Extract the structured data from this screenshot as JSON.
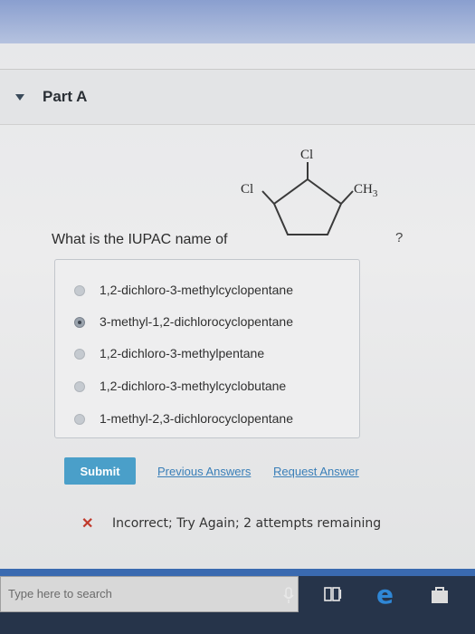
{
  "part": {
    "title": "Part A"
  },
  "molecule": {
    "substituent_left": "Cl",
    "substituent_top": "Cl",
    "substituent_right_main": "CH",
    "substituent_right_sub": "3"
  },
  "question": {
    "text": "What is the IUPAC name of",
    "help": "?"
  },
  "options": [
    {
      "label": "1,2-dichloro-3-methylcyclopentane",
      "selected": false
    },
    {
      "label": "3-methyl-1,2-dichlorocyclopentane",
      "selected": true
    },
    {
      "label": "1,2-dichloro-3-methylpentane",
      "selected": false
    },
    {
      "label": "1,2-dichloro-3-methylcyclobutane",
      "selected": false
    },
    {
      "label": "1-methyl-2,3-dichlorocyclopentane",
      "selected": false
    }
  ],
  "actions": {
    "submit": "Submit",
    "previous_answers": "Previous Answers",
    "request_answer": "Request Answer"
  },
  "feedback": {
    "icon": "x-mark-icon",
    "text": "Incorrect; Try Again; 2 attempts remaining",
    "color": "#c0392b"
  },
  "taskbar": {
    "search_placeholder": "Type here to search",
    "icons": [
      "microphone-icon",
      "task-view-icon",
      "edge-browser-icon",
      "store-icon"
    ]
  }
}
